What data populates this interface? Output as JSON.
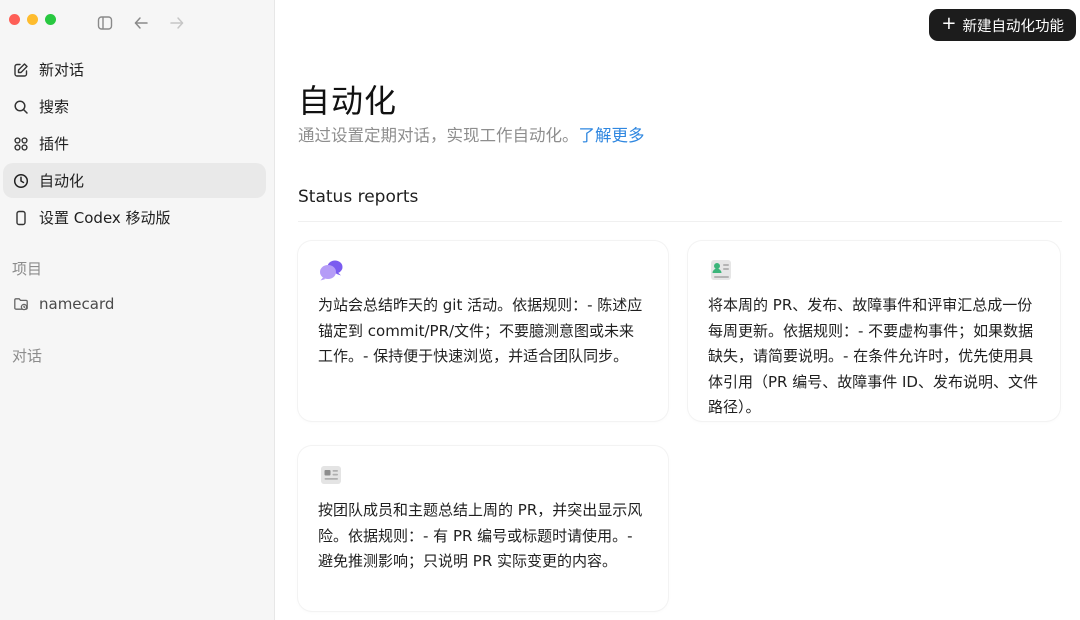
{
  "sidebar": {
    "nav": [
      {
        "label": "新对话",
        "icon": "compose-icon"
      },
      {
        "label": "搜索",
        "icon": "search-icon"
      },
      {
        "label": "插件",
        "icon": "plugins-icon"
      },
      {
        "label": "自动化",
        "icon": "clock-icon",
        "active": true
      },
      {
        "label": "设置 Codex 移动版",
        "icon": "phone-icon"
      }
    ],
    "projects_label": "项目",
    "projects": [
      {
        "label": "namecard",
        "icon": "folder-icon"
      }
    ],
    "conversations_label": "对话"
  },
  "header": {
    "new_button": "新建自动化功能"
  },
  "main": {
    "title": "自动化",
    "subtitle": "通过设置定期对话，实现工作自动化。",
    "learn_more": "了解更多",
    "group_title": "Status reports",
    "cards": [
      {
        "icon": "chat-bubbles-icon",
        "text": "为站会总结昨天的 git 活动。依据规则：- 陈述应锚定到 commit/PR/文件；不要臆测意图或未来工作。- 保持便于快速浏览，并适合团队同步。"
      },
      {
        "icon": "report-icon",
        "text": "将本周的 PR、发布、故障事件和评审汇总成一份每周更新。依据规则：- 不要虚构事件；如果数据缺失，请简要说明。- 在条件允许时，优先使用具体引用（PR 编号、故障事件 ID、发布说明、文件路径）。"
      },
      {
        "icon": "newspaper-icon",
        "text": "按团队成员和主题总结上周的 PR，并突出显示风险。依据规则：- 有 PR 编号或标题时请使用。- 避免推测影响；只说明 PR 实际变更的内容。"
      }
    ]
  },
  "colors": {
    "accent_link": "#2f87e0",
    "button_bg": "#1c1c1c",
    "sidebar_bg": "#f6f6f6"
  }
}
